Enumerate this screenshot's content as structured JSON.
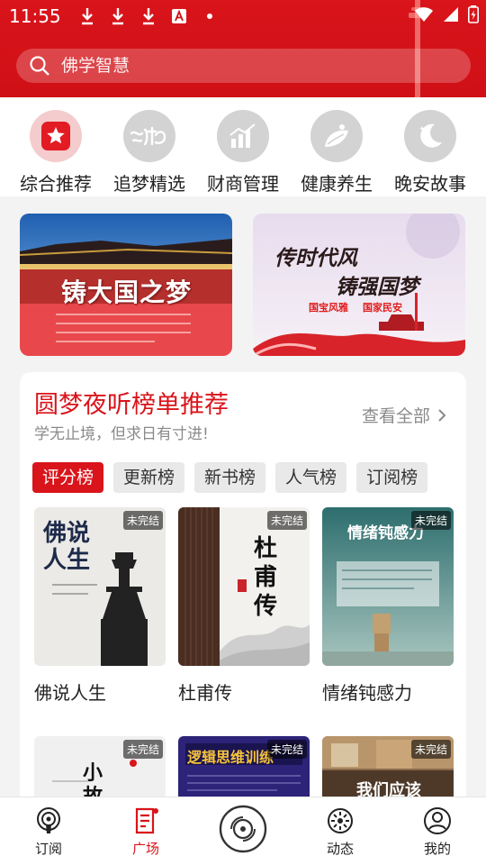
{
  "status_bar": {
    "time": "11:55"
  },
  "search": {
    "placeholder": "佛学智慧"
  },
  "categories": [
    {
      "label": "综合推荐",
      "icon": "star-icon",
      "active": true
    },
    {
      "label": "追梦精选",
      "icon": "dream-logo-icon",
      "active": false
    },
    {
      "label": "财商管理",
      "icon": "bar-chart-icon",
      "active": false
    },
    {
      "label": "健康养生",
      "icon": "leaf-icon",
      "active": false
    },
    {
      "label": "晚安故事",
      "icon": "moon-icon",
      "active": false
    }
  ],
  "banners": [
    {
      "title": "铸大国之梦"
    },
    {
      "title_line1": "传时代风",
      "title_line2": "铸强国梦",
      "tag1": "国宝风雅",
      "tag2": "国家民安"
    }
  ],
  "ranking": {
    "title": "圆梦夜听榜单推荐",
    "subtitle": "学无止境，但求日有寸进!",
    "view_all": "查看全部",
    "tabs": [
      "评分榜",
      "更新榜",
      "新书榜",
      "人气榜",
      "订阅榜"
    ],
    "active_tab": 0,
    "books": [
      {
        "title": "佛说人生",
        "badge": "未完结",
        "cover_text": "佛说人生"
      },
      {
        "title": "杜甫传",
        "badge": "未完结",
        "cover_text": "杜甫传"
      },
      {
        "title": "情绪钝感力",
        "badge": "未完结",
        "cover_text": "情绪钝感力"
      },
      {
        "title": "",
        "badge": "未完结",
        "cover_text": "小故"
      },
      {
        "title": "",
        "badge": "未完结",
        "cover_text": "逻辑思维训练"
      },
      {
        "title": "",
        "badge": "未完结",
        "cover_text": "我们应该"
      }
    ]
  },
  "bottom_nav": [
    {
      "label": "订阅",
      "icon": "podcast-icon"
    },
    {
      "label": "广场",
      "icon": "square-list-icon",
      "active": true
    },
    {
      "label": "",
      "icon": "disc-icon"
    },
    {
      "label": "动态",
      "icon": "activity-icon"
    },
    {
      "label": "我的",
      "icon": "profile-icon"
    }
  ],
  "colors": {
    "brand_red": "#d9141b",
    "muted_text": "#8a8a8a"
  }
}
